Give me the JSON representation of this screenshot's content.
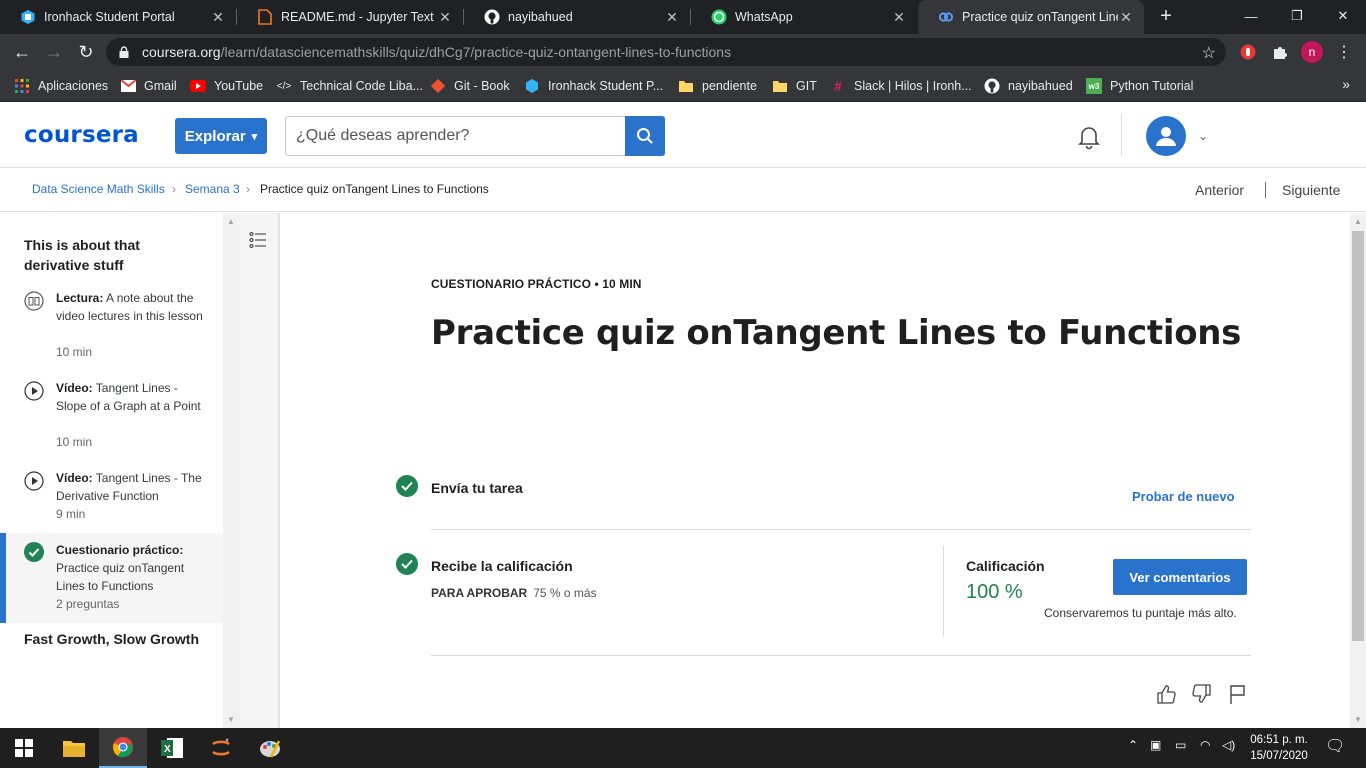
{
  "browser": {
    "tabs": [
      {
        "title": "Ironhack Student Portal",
        "icon": "ironhack-icon"
      },
      {
        "title": "README.md - Jupyter Text Edit",
        "icon": "jupyter-file-icon"
      },
      {
        "title": "nayibahued",
        "icon": "github-icon"
      },
      {
        "title": "WhatsApp",
        "icon": "whatsapp-icon"
      },
      {
        "title": "Practice quiz onTangent Lines t",
        "icon": "coursera-icon",
        "active": true
      }
    ],
    "url_domain": "coursera.org",
    "url_path": "/learn/datasciencemathskills/quiz/dhCg7/practice-quiz-ontangent-lines-to-functions",
    "profile_initial": "n",
    "bookmarks": [
      {
        "label": "Aplicaciones",
        "icon": "apps-grid-icon"
      },
      {
        "label": "Gmail",
        "icon": "gmail-icon"
      },
      {
        "label": "YouTube",
        "icon": "youtube-icon"
      },
      {
        "label": "Technical Code Liba...",
        "icon": "code-icon"
      },
      {
        "label": "Git - Book",
        "icon": "git-icon"
      },
      {
        "label": "Ironhack Student P...",
        "icon": "ironhack-icon"
      },
      {
        "label": "pendiente",
        "icon": "folder-icon"
      },
      {
        "label": "GIT",
        "icon": "folder-icon"
      },
      {
        "label": "Slack | Hilos | Ironh...",
        "icon": "slack-icon"
      },
      {
        "label": "nayibahued",
        "icon": "github-icon"
      },
      {
        "label": "Python Tutorial",
        "icon": "w3-icon"
      }
    ]
  },
  "header": {
    "logo": "coursera",
    "explore_label": "Explorar",
    "search_placeholder": "¿Qué deseas aprender?"
  },
  "breadcrumb": {
    "items": [
      "Data Science Math Skills",
      "Semana 3",
      "Practice quiz onTangent Lines to Functions"
    ],
    "prev_label": "Anterior",
    "next_label": "Siguiente"
  },
  "sidebar": {
    "section_title": "This is about that derivative stuff",
    "items": [
      {
        "type_label": "Lectura:",
        "title": "A note about the video lectures in this lesson",
        "duration": "10 min",
        "icon": "reading-book-icon"
      },
      {
        "type_label": "Vídeo:",
        "title": "Tangent Lines - Slope of a Graph at a Point",
        "duration": "10 min",
        "icon": "play-circle-icon"
      },
      {
        "type_label": "Vídeo:",
        "title": "Tangent Lines - The Derivative Function",
        "duration": "9 min",
        "icon": "play-circle-icon"
      },
      {
        "type_label": "Cuestionario práctico:",
        "title": "Practice quiz onTangent Lines to Functions",
        "duration": "2 preguntas",
        "icon": "check-circle-icon",
        "active": true
      }
    ],
    "next_section_title": "Fast Growth, Slow Growth"
  },
  "main": {
    "kicker": "CUESTIONARIO PRÁCTICO • 10 MIN",
    "title": "Practice quiz onTangent Lines to Functions",
    "step1_title": "Envía tu tarea",
    "retry_label": "Probar de nuevo",
    "step2_title": "Recibe la calificación",
    "pass_label": "PARA APROBAR",
    "pass_value": "75 % o más",
    "grade_label": "Calificación",
    "grade_value": "100 %",
    "feedback_label": "Ver comentarios",
    "keep_note": "Conservaremos tu puntaje más alto."
  },
  "taskbar": {
    "time": "06:51 p. m.",
    "date": "15/07/2020"
  },
  "colors": {
    "brand_blue": "#2a73cc",
    "success_green": "#1f8354",
    "chrome_dark": "#202124"
  }
}
